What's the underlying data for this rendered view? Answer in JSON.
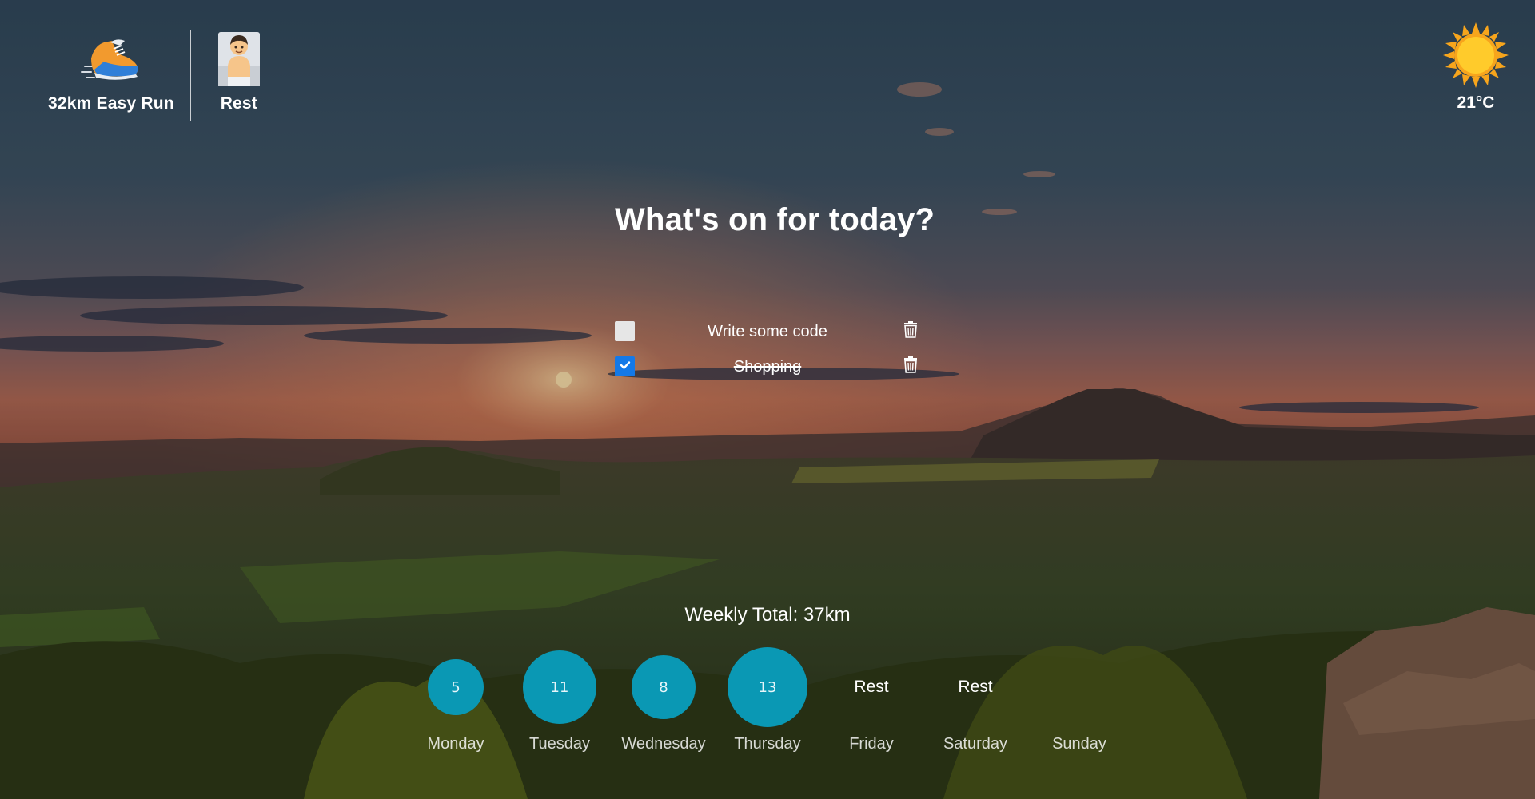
{
  "plan": {
    "today": {
      "label": "32km Easy Run",
      "icon": "running-shoe-icon"
    },
    "tomorrow": {
      "label": "Rest",
      "icon": "person-resting-icon"
    }
  },
  "weather": {
    "temperature": "21°C",
    "icon": "sun-icon"
  },
  "todo": {
    "title": "What's on for today?",
    "input_value": "",
    "items": [
      {
        "text": "Write some code",
        "checked": false
      },
      {
        "text": "Shopping",
        "checked": true
      }
    ]
  },
  "weekly": {
    "total_label": "Weekly Total: 37km",
    "days": [
      {
        "name": "Monday",
        "value": "5",
        "type": "run"
      },
      {
        "name": "Tuesday",
        "value": "11",
        "type": "run"
      },
      {
        "name": "Wednesday",
        "value": "8",
        "type": "run"
      },
      {
        "name": "Thursday",
        "value": "13",
        "type": "run"
      },
      {
        "name": "Friday",
        "value": "Rest",
        "type": "rest"
      },
      {
        "name": "Saturday",
        "value": "Rest",
        "type": "rest"
      },
      {
        "name": "Sunday",
        "value": "",
        "type": "empty"
      }
    ]
  },
  "colors": {
    "bubble": "#0a98b4",
    "checkbox_checked": "#1479e8",
    "checkbox_unchecked": "#e6e6e6"
  }
}
